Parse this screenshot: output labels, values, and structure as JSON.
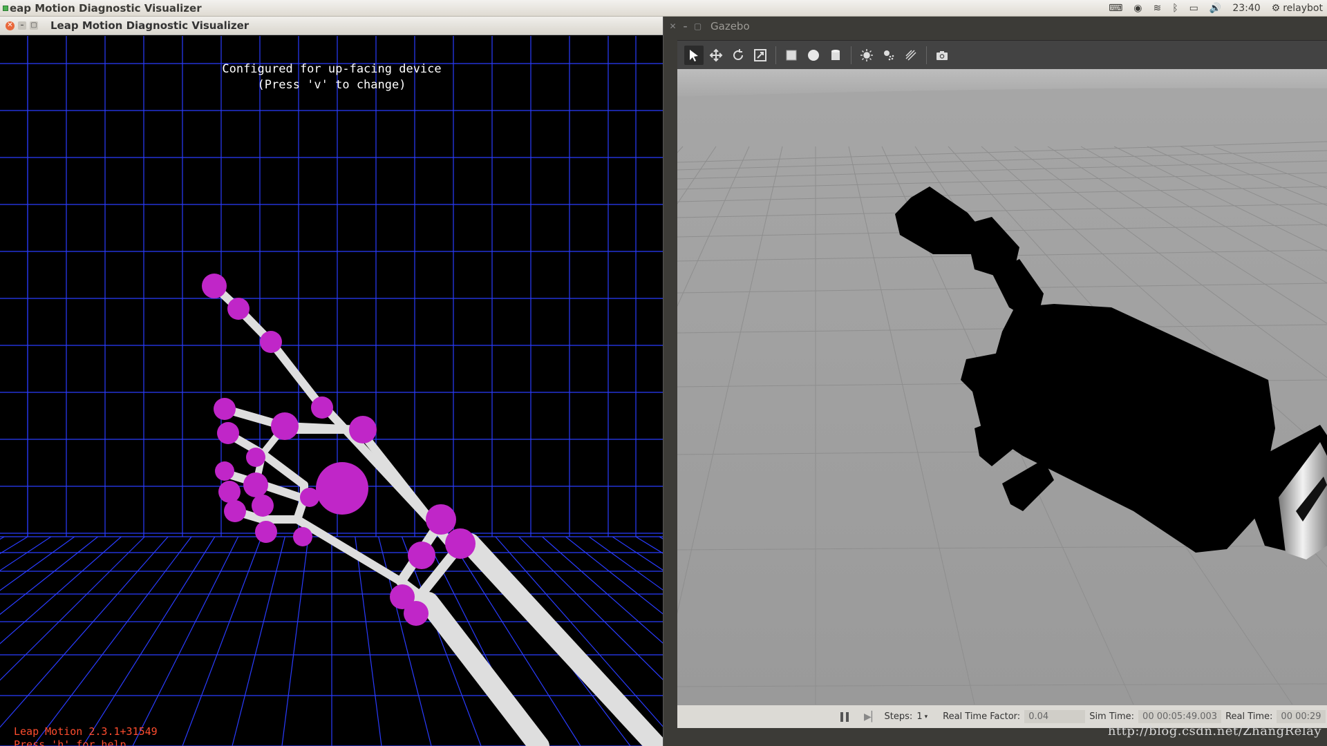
{
  "top_panel": {
    "app_title": "eap Motion Diagnostic Visualizer",
    "clock": "23:40",
    "user": "relaybot"
  },
  "leap_window": {
    "title": "Leap Motion Diagnostic Visualizer",
    "config_line1": "Configured for up-facing device",
    "config_line2": "(Press 'v' to change)",
    "version": "Leap Motion 2.3.1+31549",
    "help": "Press 'h' for help",
    "colors": {
      "grid": "#2a3cff",
      "joint": "#c026c8",
      "bone": "#e0e0e0",
      "warning_text": "#ff4d2e"
    }
  },
  "gazebo_window": {
    "title": "Gazebo",
    "toolbar": {
      "tools": [
        {
          "name": "select-arrow-icon",
          "active": true
        },
        {
          "name": "translate-icon",
          "active": false
        },
        {
          "name": "rotate-icon",
          "active": false
        },
        {
          "name": "scale-icon",
          "active": false
        },
        {
          "name": "box-shape-icon",
          "active": false
        },
        {
          "name": "sphere-shape-icon",
          "active": false
        },
        {
          "name": "cylinder-shape-icon",
          "active": false
        },
        {
          "name": "point-light-icon",
          "active": false
        },
        {
          "name": "spot-light-icon",
          "active": false
        },
        {
          "name": "directional-light-icon",
          "active": false
        },
        {
          "name": "screenshot-camera-icon",
          "active": false
        }
      ]
    },
    "status": {
      "steps_label": "Steps:",
      "steps_value": "1",
      "rtf_label": "Real Time Factor:",
      "rtf_value": "0.04",
      "sim_time_label": "Sim Time:",
      "sim_time_value": "00 00:05:49.003",
      "real_time_label": "Real Time:",
      "real_time_value": "00 00:29"
    }
  },
  "watermark": "http://blog.csdn.net/ZhangRelay"
}
